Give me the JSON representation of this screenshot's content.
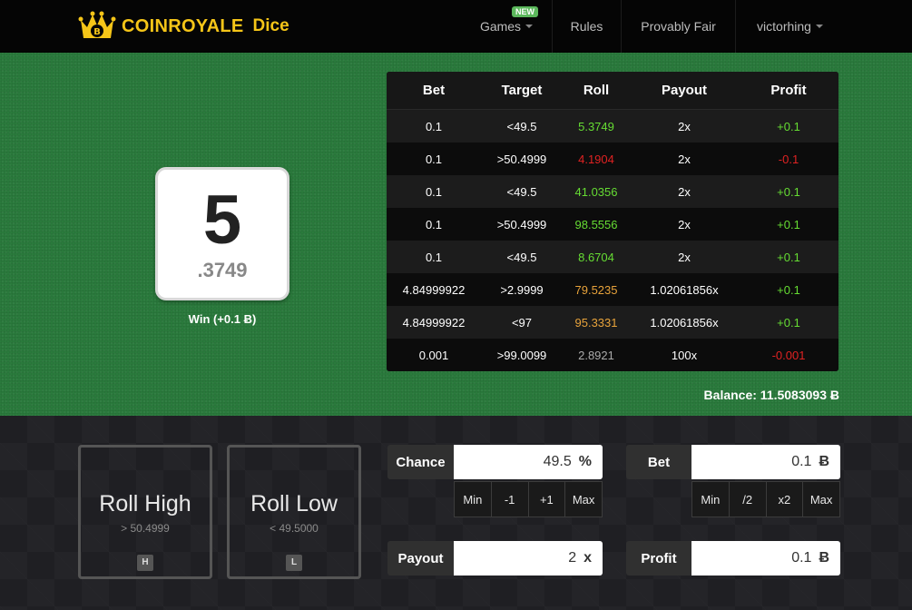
{
  "nav": {
    "brand_coin": "COIN",
    "brand_royale": "ROYALE",
    "brand_sub": "Dice",
    "games": "Games",
    "games_badge": "NEW",
    "rules": "Rules",
    "provably_fair": "Provably Fair",
    "user": "victorhing"
  },
  "die": {
    "integer": "5",
    "fraction": ".3749",
    "result_text": "Win (+0.1 Ƀ)"
  },
  "history": {
    "headers": [
      "Bet",
      "Target",
      "Roll",
      "Payout",
      "Profit"
    ],
    "rows": [
      {
        "bet": "0.1",
        "target": "<49.5",
        "roll": "5.3749",
        "roll_color": "green",
        "payout": "2x",
        "profit": "+0.1",
        "profit_color": "green"
      },
      {
        "bet": "0.1",
        "target": ">50.4999",
        "roll": "4.1904",
        "roll_color": "red",
        "payout": "2x",
        "profit": "-0.1",
        "profit_color": "red"
      },
      {
        "bet": "0.1",
        "target": "<49.5",
        "roll": "41.0356",
        "roll_color": "green",
        "payout": "2x",
        "profit": "+0.1",
        "profit_color": "green"
      },
      {
        "bet": "0.1",
        "target": ">50.4999",
        "roll": "98.5556",
        "roll_color": "green",
        "payout": "2x",
        "profit": "+0.1",
        "profit_color": "green"
      },
      {
        "bet": "0.1",
        "target": "<49.5",
        "roll": "8.6704",
        "roll_color": "green",
        "payout": "2x",
        "profit": "+0.1",
        "profit_color": "green"
      },
      {
        "bet": "4.84999922",
        "target": ">2.9999",
        "roll": "79.5235",
        "roll_color": "orange",
        "payout": "1.02061856x",
        "profit": "+0.1",
        "profit_color": "green"
      },
      {
        "bet": "4.84999922",
        "target": "<97",
        "roll": "95.3331",
        "roll_color": "orange",
        "payout": "1.02061856x",
        "profit": "+0.1",
        "profit_color": "green"
      },
      {
        "bet": "0.001",
        "target": ">99.0099",
        "roll": "2.8921",
        "roll_color": "gray",
        "payout": "100x",
        "profit": "-0.001",
        "profit_color": "red"
      }
    ]
  },
  "balance": "Balance: 11.5083093 Ƀ",
  "roll_high": {
    "title": "Roll High",
    "sub": "> 50.4999",
    "key": "H"
  },
  "roll_low": {
    "title": "Roll Low",
    "sub": "< 49.5000",
    "key": "L"
  },
  "chance": {
    "label": "Chance",
    "value": "49.5",
    "unit": "%",
    "buttons": [
      "Min",
      "-1",
      "+1",
      "Max"
    ]
  },
  "bet": {
    "label": "Bet",
    "value": "0.1",
    "unit": "Ƀ",
    "buttons": [
      "Min",
      "/2",
      "x2",
      "Max"
    ]
  },
  "payout": {
    "label": "Payout",
    "value": "2",
    "unit": "x"
  },
  "profit": {
    "label": "Profit",
    "value": "0.1",
    "unit": "Ƀ"
  },
  "colors": {
    "felt": "#2a7a3c",
    "brand": "#f5c518",
    "win": "#66dd33",
    "loss": "#e02222",
    "warn": "#e8a33b"
  }
}
